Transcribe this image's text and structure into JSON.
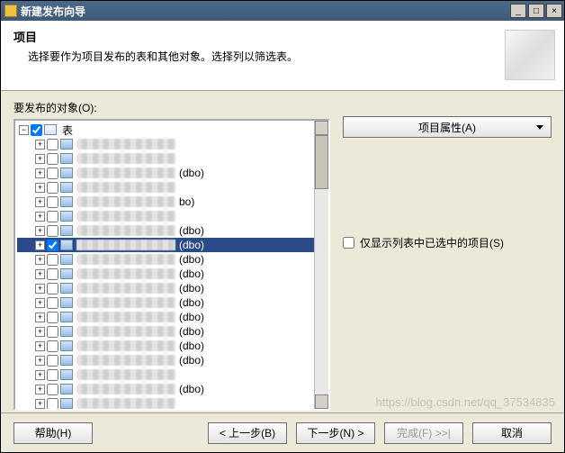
{
  "window": {
    "title": "新建发布向导",
    "min": "_",
    "max": "□",
    "close": "×"
  },
  "header": {
    "heading": "项目",
    "subheading": "选择要作为项目发布的表和其他对象。选择列以筛选表。"
  },
  "left": {
    "label": "要发布的对象(O):",
    "root": {
      "label": "表",
      "checked": true
    },
    "rows": [
      {
        "checked": false,
        "suffix": ""
      },
      {
        "checked": false,
        "suffix": ""
      },
      {
        "checked": false,
        "suffix": "(dbo)"
      },
      {
        "checked": false,
        "suffix": ""
      },
      {
        "checked": false,
        "suffix": "bo)"
      },
      {
        "checked": false,
        "suffix": ""
      },
      {
        "checked": false,
        "suffix": "(dbo)"
      },
      {
        "checked": true,
        "suffix": "(dbo)",
        "selected": true
      },
      {
        "checked": false,
        "suffix": "(dbo)"
      },
      {
        "checked": false,
        "suffix": "(dbo)"
      },
      {
        "checked": false,
        "suffix": "(dbo)"
      },
      {
        "checked": false,
        "suffix": "(dbo)"
      },
      {
        "checked": false,
        "suffix": "(dbo)"
      },
      {
        "checked": false,
        "suffix": "(dbo)"
      },
      {
        "checked": false,
        "suffix": "(dbo)"
      },
      {
        "checked": false,
        "suffix": "(dbo)"
      },
      {
        "checked": false,
        "suffix": ""
      },
      {
        "checked": false,
        "suffix": "(dbo)"
      },
      {
        "checked": false,
        "suffix": ""
      }
    ]
  },
  "right": {
    "propsBtn": "项目属性(A)",
    "onlyShow": "仅显示列表中已选中的项目(S)",
    "onlyShowChecked": false
  },
  "footer": {
    "help": "帮助(H)",
    "back": "< 上一步(B)",
    "next": "下一步(N) >",
    "finish": "完成(F) >>|",
    "cancel": "取消"
  },
  "watermark": "https://blog.csdn.net/qq_37534835"
}
